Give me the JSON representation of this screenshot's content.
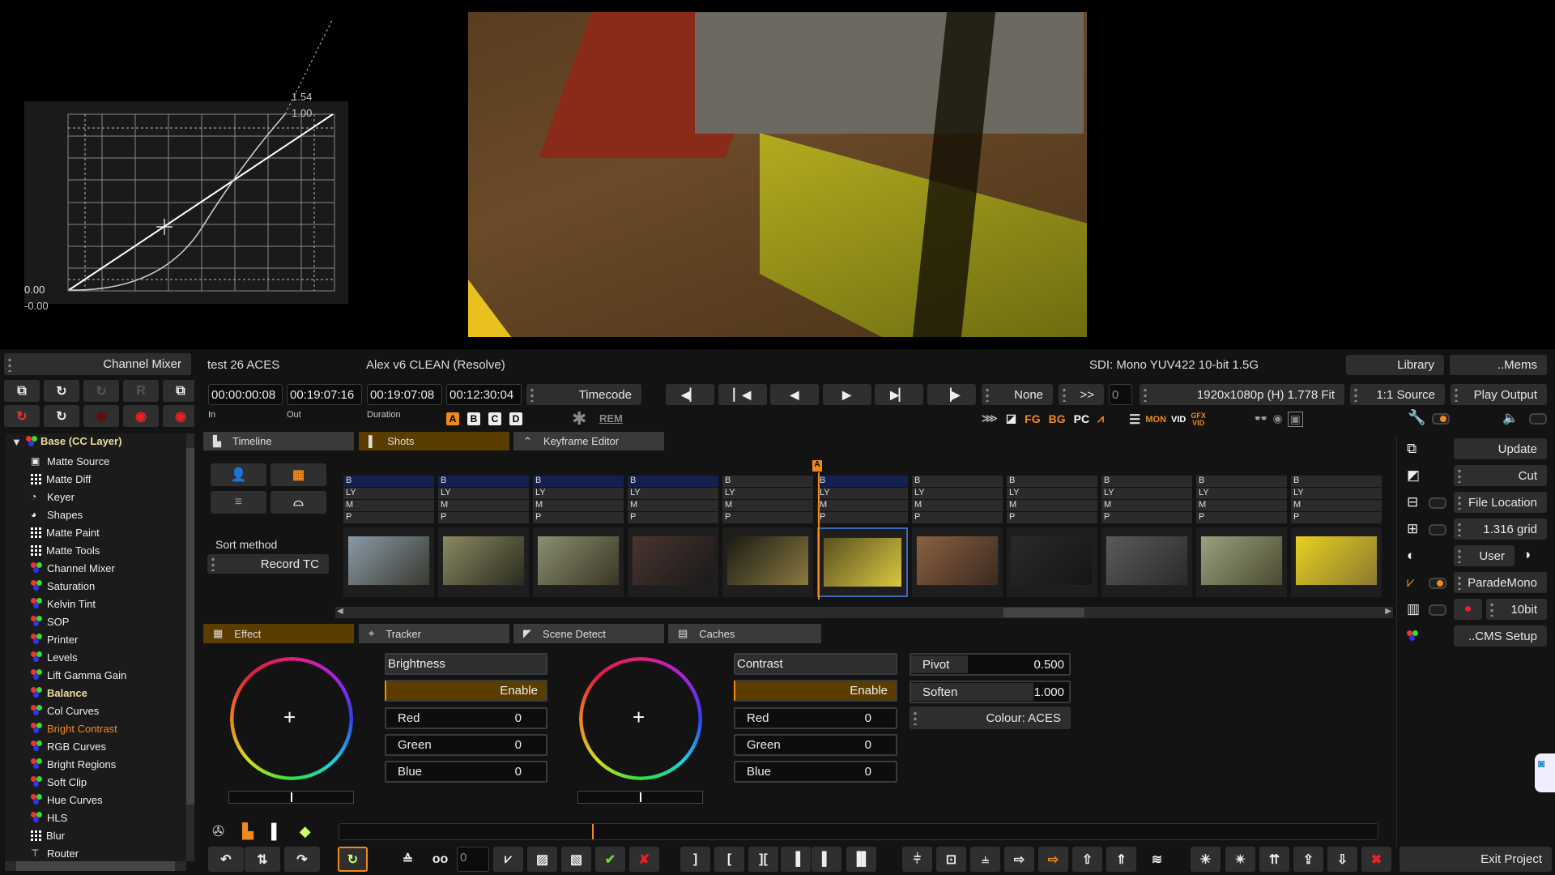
{
  "curve": {
    "label_top1": "1.54",
    "label_top2": "1.00",
    "label_bottom1": "0.00",
    "label_bottom2": "-0.00"
  },
  "layer_panel": {
    "title": "Channel Mixer",
    "tree_root": "Base (CC Layer)",
    "items": [
      {
        "label": "Matte Source",
        "icon": "matte-source-icon"
      },
      {
        "label": "Matte Diff",
        "icon": "grid-icon"
      },
      {
        "label": "Keyer",
        "icon": "keyer-icon"
      },
      {
        "label": "Shapes",
        "icon": "shapes-icon"
      },
      {
        "label": "Matte Paint",
        "icon": "grid-icon"
      },
      {
        "label": "Matte Tools",
        "icon": "grid-icon"
      },
      {
        "label": "Channel Mixer",
        "icon": "rgb-icon"
      },
      {
        "label": "Saturation",
        "icon": "rgb-icon"
      },
      {
        "label": "Kelvin Tint",
        "icon": "rgb-icon"
      },
      {
        "label": "SOP",
        "icon": "rgb-icon"
      },
      {
        "label": "Printer",
        "icon": "rgb-icon"
      },
      {
        "label": "Levels",
        "icon": "rgb-icon"
      },
      {
        "label": "Lift Gamma Gain",
        "icon": "rgb-icon"
      },
      {
        "label": "Balance",
        "icon": "rgb-icon",
        "state": "bold"
      },
      {
        "label": "Col Curves",
        "icon": "rgb-icon"
      },
      {
        "label": "Bright Contrast",
        "icon": "rgb-icon",
        "state": "active"
      },
      {
        "label": "RGB Curves",
        "icon": "rgb-icon"
      },
      {
        "label": "Bright Regions",
        "icon": "rgb-icon"
      },
      {
        "label": "Soft Clip",
        "icon": "rgb-icon"
      },
      {
        "label": "Hue Curves",
        "icon": "rgb-icon"
      },
      {
        "label": "HLS",
        "icon": "rgb-icon"
      },
      {
        "label": "Blur",
        "icon": "grid-icon"
      },
      {
        "label": "Router",
        "icon": "router-icon"
      }
    ]
  },
  "info": {
    "project": "test 26 ACES",
    "grade": "Alex v6 CLEAN (Resolve)",
    "sdi": "SDI: Mono YUV422 10-bit 1.5G",
    "library": "Library",
    "mems": "..Mems"
  },
  "timecode": {
    "in": "00:00:00:08",
    "out": "00:19:07:16",
    "duration": "00:19:07:08",
    "current": "00:12:30:04",
    "mode": "Timecode",
    "in_label": "In",
    "out_label": "Out",
    "duration_label": "Duration",
    "abcd": [
      "A",
      "B",
      "C",
      "D"
    ],
    "rem": "REM"
  },
  "transport": {
    "none": "None",
    "step": ">>",
    "frame": "0",
    "format": "1920x1080p (H) 1.778 Fit",
    "source": "1:1 Source",
    "play_output": "Play Output"
  },
  "indicators": {
    "fg": "FG",
    "bg": "BG",
    "pc": "PC",
    "mon": "MON",
    "vid": "VID",
    "gfx": "GFX",
    "gfx_vid": "VID"
  },
  "tabs": {
    "timeline": "Timeline",
    "shots": "Shots",
    "keyframe": "Keyframe Editor"
  },
  "shots": {
    "sort_label": "Sort method",
    "sort_value": "Record TC",
    "playhead_marker": "A",
    "row_labels": [
      "B",
      "LY",
      "M",
      "P"
    ],
    "clips": [
      {
        "sel": true,
        "c": [
          "#8a9aa8",
          "#3a3a30"
        ]
      },
      {
        "sel": true,
        "c": [
          "#8a8a60",
          "#2a2a20"
        ]
      },
      {
        "sel": true,
        "c": [
          "#8a9070",
          "#3a3525"
        ]
      },
      {
        "sel": true,
        "c": [
          "#4a3530",
          "#1a1a1a"
        ]
      },
      {
        "sel": false,
        "c": [
          "#1a1a14",
          "#8a7a40"
        ]
      },
      {
        "sel": true,
        "current": true,
        "c": [
          "#5a5020",
          "#d8c840"
        ]
      },
      {
        "sel": false,
        "c": [
          "#8a6040",
          "#3a2a20"
        ]
      },
      {
        "sel": false,
        "c": [
          "#2a2a2a",
          "#151515"
        ]
      },
      {
        "sel": false,
        "c": [
          "#5a5a5a",
          "#2a2a2a"
        ]
      },
      {
        "sel": false,
        "c": [
          "#9aa080",
          "#4a4a30"
        ]
      },
      {
        "sel": false,
        "c": [
          "#e8d020",
          "#8a7a30"
        ]
      }
    ]
  },
  "effect_tabs": {
    "effect": "Effect",
    "tracker": "Tracker",
    "scene": "Scene Detect",
    "caches": "Caches"
  },
  "brightness": {
    "title": "Brightness",
    "enable": "Enable",
    "red_label": "Red",
    "red": "0",
    "green_label": "Green",
    "green": "0",
    "blue_label": "Blue",
    "blue": "0"
  },
  "contrast": {
    "title": "Contrast",
    "enable": "Enable",
    "red_label": "Red",
    "red": "0",
    "green_label": "Green",
    "green": "0",
    "blue_label": "Blue",
    "blue": "0"
  },
  "pivot": {
    "pivot_label": "Pivot",
    "pivot": "0.500",
    "soften_label": "Soften",
    "soften": "1.000",
    "colour": "Colour: ACES"
  },
  "right_panel": {
    "update": "Update",
    "cut": "Cut",
    "file_location": "File Location",
    "grid": "1.316 grid",
    "user": "User",
    "scope": "ParadeMono",
    "bits": "10bit",
    "cms": "..CMS Setup"
  },
  "bottom": {
    "frame_value": "0",
    "exit": "Exit Project"
  },
  "colors": {
    "accent": "#f08a1c",
    "active_tab": "#5c3d00",
    "selection": "#14204e"
  }
}
